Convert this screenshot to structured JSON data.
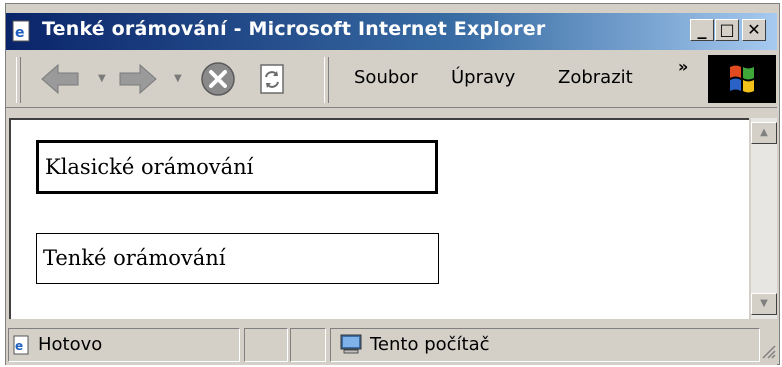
{
  "window": {
    "title": "Tenké orámování - Microsoft Internet Explorer"
  },
  "title_buttons": {
    "minimize": "_",
    "maximize": "□",
    "close": "✕"
  },
  "toolbar": {
    "back_icon": "back-arrow-icon",
    "forward_icon": "forward-arrow-icon",
    "stop_icon": "stop-icon",
    "refresh_icon": "refresh-icon",
    "overflow": "»",
    "menu": [
      {
        "label": "Soubor"
      },
      {
        "label": "Úpravy"
      },
      {
        "label": "Zobrazit"
      }
    ]
  },
  "content": {
    "box1_text": "Klasické orámování",
    "box2_text": "Tenké orámování"
  },
  "statusbar": {
    "status": "Hotovo",
    "zone": "Tento počítač"
  },
  "colors": {
    "titlebar_start": "#0a246a",
    "titlebar_end": "#a6caf0",
    "chrome": "#d4d0c8"
  }
}
